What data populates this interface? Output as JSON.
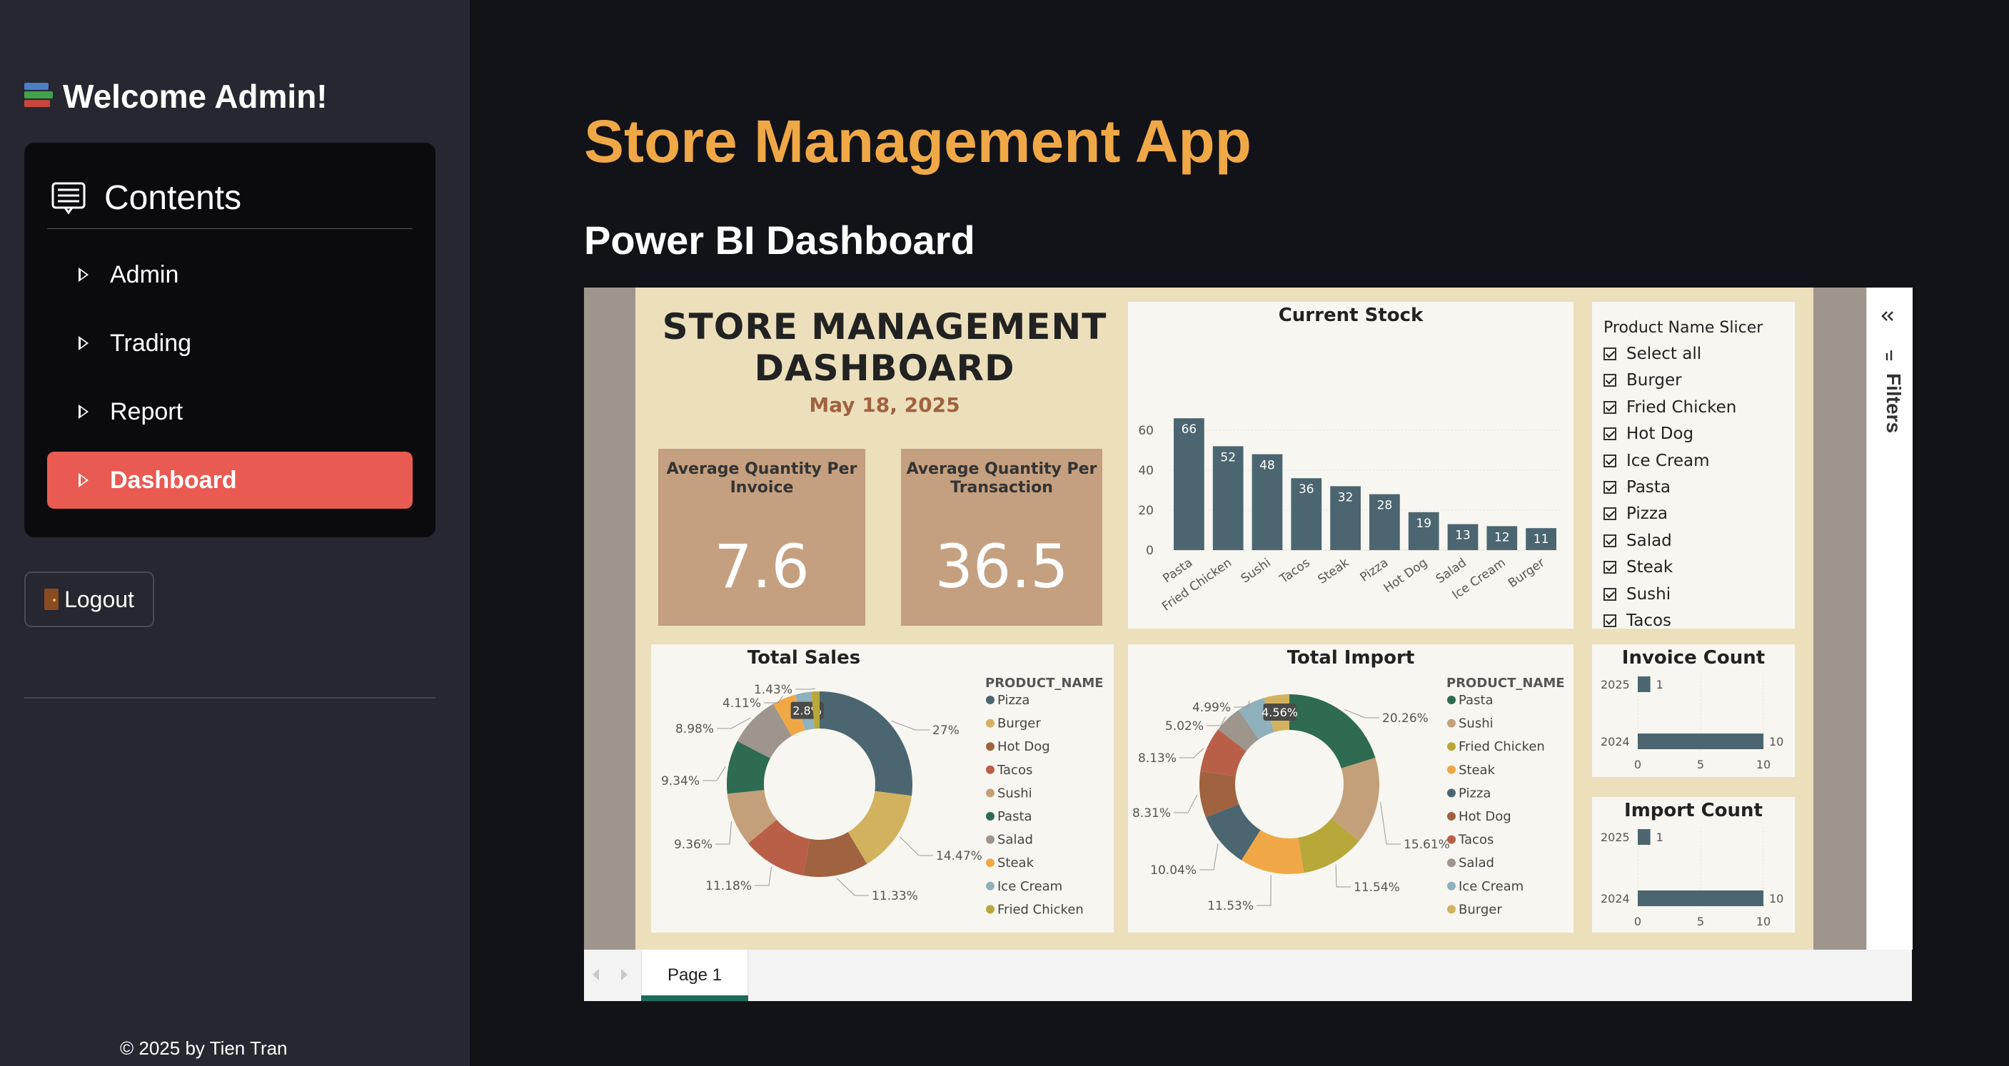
{
  "sidebar": {
    "welcome": "Welcome Admin!",
    "contents_title": "Contents",
    "items": [
      {
        "label": "Admin"
      },
      {
        "label": "Trading"
      },
      {
        "label": "Report"
      },
      {
        "label": "Dashboard",
        "active": true
      }
    ],
    "logout_label": "Logout",
    "footer": "© 2025 by Tien Tran"
  },
  "main": {
    "title": "Store Management App",
    "subtitle": "Power BI Dashboard"
  },
  "report": {
    "title_line1": "STORE MANAGEMENT",
    "title_line2": "DASHBOARD",
    "date": "May 18, 2025",
    "kpis": [
      {
        "label": "Average Quantity Per Invoice",
        "value": "7.6"
      },
      {
        "label": "Average Quantity Per Transaction",
        "value": "36.5"
      }
    ],
    "slicer": {
      "title": "Product Name Slicer",
      "options": [
        "Select all",
        "Burger",
        "Fried Chicken",
        "Hot Dog",
        "Ice Cream",
        "Pasta",
        "Pizza",
        "Salad",
        "Steak",
        "Sushi",
        "Tacos"
      ]
    },
    "filters_label": "Filters",
    "page_tab": "Page 1",
    "colors": {
      "bar": "#4b6670",
      "accent": "#f0a847",
      "active_menu": "#e95a52"
    }
  },
  "chart_data": [
    {
      "type": "bar",
      "title": "Current Stock",
      "categories": [
        "Pasta",
        "Fried Chicken",
        "Sushi",
        "Tacos",
        "Steak",
        "Pizza",
        "Hot Dog",
        "Salad",
        "Ice Cream",
        "Burger"
      ],
      "values": [
        66,
        52,
        48,
        36,
        32,
        28,
        19,
        13,
        12,
        11
      ],
      "yticks": [
        0,
        20,
        40,
        60
      ],
      "ylim": [
        0,
        70
      ]
    },
    {
      "type": "pie",
      "title": "Total Sales",
      "legend_title": "PRODUCT_NAME",
      "labels": [
        "Pizza",
        "Burger",
        "Hot Dog",
        "Tacos",
        "Sushi",
        "Pasta",
        "Salad",
        "Steak",
        "Ice Cream",
        "Fried Chicken"
      ],
      "values": [
        27,
        14.47,
        11.33,
        11.18,
        9.36,
        9.34,
        8.98,
        4.11,
        2.8,
        1.43
      ],
      "value_labels": [
        "27%",
        "14.47%",
        "11.33%",
        "11.18%",
        "9.36%",
        "9.34%",
        "8.98%",
        "4.11%",
        "2.8%",
        "1.43%"
      ],
      "colors": [
        "#4b6670",
        "#d2b25e",
        "#a0623f",
        "#b95f47",
        "#c4a07a",
        "#2e6b50",
        "#9e958c",
        "#f0a847",
        "#8fb0bd",
        "#b8a83a"
      ]
    },
    {
      "type": "pie",
      "title": "Total Import",
      "legend_title": "PRODUCT_NAME",
      "labels": [
        "Pasta",
        "Sushi",
        "Fried Chicken",
        "Steak",
        "Pizza",
        "Hot Dog",
        "Tacos",
        "Salad",
        "Ice Cream",
        "Burger"
      ],
      "values": [
        20.26,
        15.61,
        11.54,
        11.53,
        10.04,
        8.31,
        8.13,
        5.02,
        4.99,
        4.56
      ],
      "value_labels": [
        "20.26%",
        "15.61%",
        "11.54%",
        "11.53%",
        "10.04%",
        "8.31%",
        "8.13%",
        "5.02%",
        "4.99%",
        "4.56%"
      ],
      "colors": [
        "#2e6b50",
        "#c4a07a",
        "#b8a83a",
        "#f0a847",
        "#4b6670",
        "#a0623f",
        "#b95f47",
        "#9e958c",
        "#8fb0bd",
        "#d2b25e"
      ]
    },
    {
      "type": "bar",
      "orientation": "horizontal",
      "title": "Invoice Count",
      "categories": [
        "2025",
        "2024"
      ],
      "values": [
        1,
        10
      ],
      "xticks": [
        0,
        5,
        10
      ]
    },
    {
      "type": "bar",
      "orientation": "horizontal",
      "title": "Import Count",
      "categories": [
        "2025",
        "2024"
      ],
      "values": [
        1,
        10
      ],
      "xticks": [
        0,
        5,
        10
      ]
    }
  ]
}
